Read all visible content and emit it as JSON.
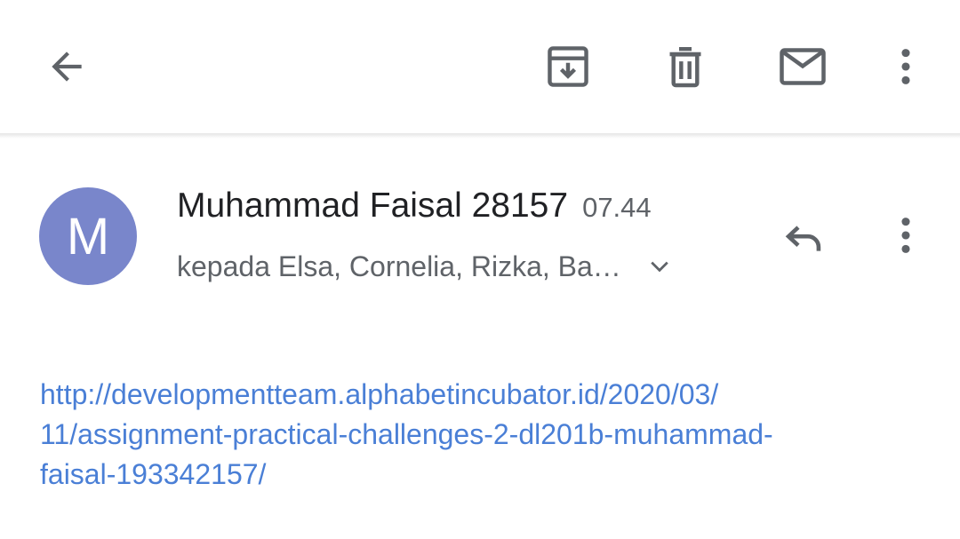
{
  "toolbar": {
    "back_icon": "arrow-back-icon",
    "archive_icon": "archive-icon",
    "delete_icon": "trash-icon",
    "mark_unread_icon": "mail-icon",
    "more_icon": "more-vert-icon"
  },
  "message": {
    "avatar_letter": "M",
    "avatar_color": "#7986cb",
    "sender_name": "Muhammad Faisal 28157",
    "time": "07.44",
    "recipients": "kepada Elsa, Cornelia, Rizka, Ba…",
    "reply_icon": "reply-icon",
    "more_icon": "more-vert-icon",
    "expand_icon": "chevron-down-icon"
  },
  "body": {
    "link_lines": [
      "http://developmentteam.alphabetincubator.id/2020/03/",
      "11/assignment-practical-challenges-2-dl201b-muhammad-",
      "faisal-193342157/"
    ],
    "link_color": "#4a7fd6"
  }
}
